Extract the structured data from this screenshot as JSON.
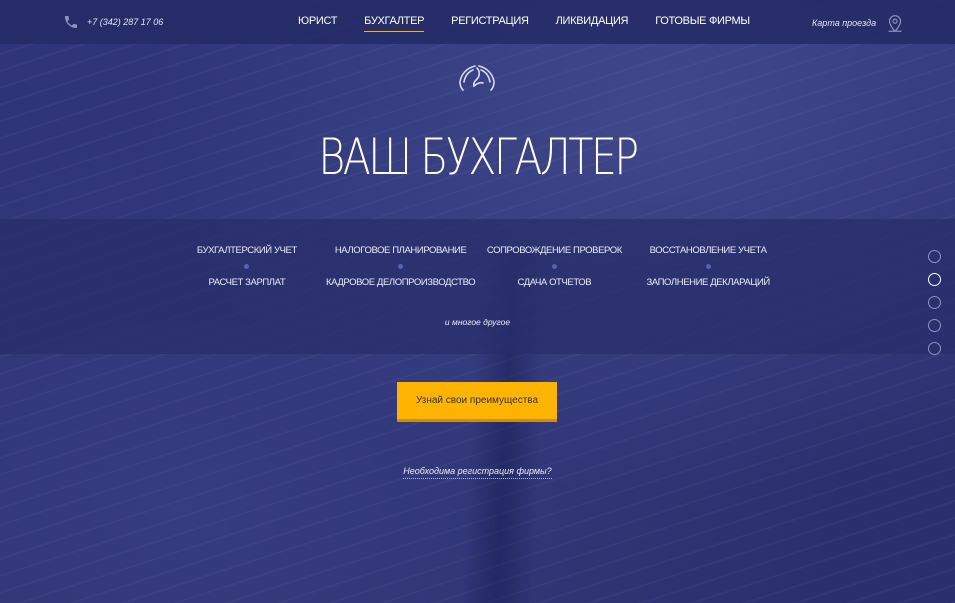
{
  "header": {
    "phone": "+7 (342) 287 17 06",
    "nav": [
      {
        "label": "ЮРИСТ",
        "active": false
      },
      {
        "label": "БУХГАЛТЕР",
        "active": true
      },
      {
        "label": "РЕГИСТРАЦИЯ",
        "active": false
      },
      {
        "label": "ЛИКВИДАЦИЯ",
        "active": false
      },
      {
        "label": "ГОТОВЫЕ ФИРМЫ",
        "active": false
      }
    ],
    "map_link": "Карта проезда"
  },
  "hero": {
    "title": "ВАШ БУХГАЛТЕР",
    "services_top": [
      "БУХГАЛТЕРСКИЙ УЧЕТ",
      "НАЛОГОВОЕ ПЛАНИРОВАНИЕ",
      "СОПРОВОЖДЕНИЕ ПРОВЕРОК",
      "ВОССТАНОВЛЕНИЕ УЧЕТА"
    ],
    "services_bottom": [
      "РАСЧЕТ ЗАРПЛАТ",
      "КАДРОВОЕ ДЕЛОПРОИЗВОДСТВО",
      "СДАЧА ОТЧЕТОВ",
      "ЗАПОЛНЕНИЕ ДЕКЛАРАЦИЙ"
    ],
    "more": "и многое другое",
    "cta_label": "Узнай свои преимущества",
    "reg_link": "Необходима регистрация фирмы?"
  },
  "pager": {
    "count": 5,
    "active_index": 1
  },
  "colors": {
    "accent": "#ffb400",
    "background": "#2e3373",
    "dot": "#5662b3"
  },
  "icons": {
    "phone": "phone-icon",
    "map": "map-pin-icon",
    "logo": "wings-logo"
  }
}
